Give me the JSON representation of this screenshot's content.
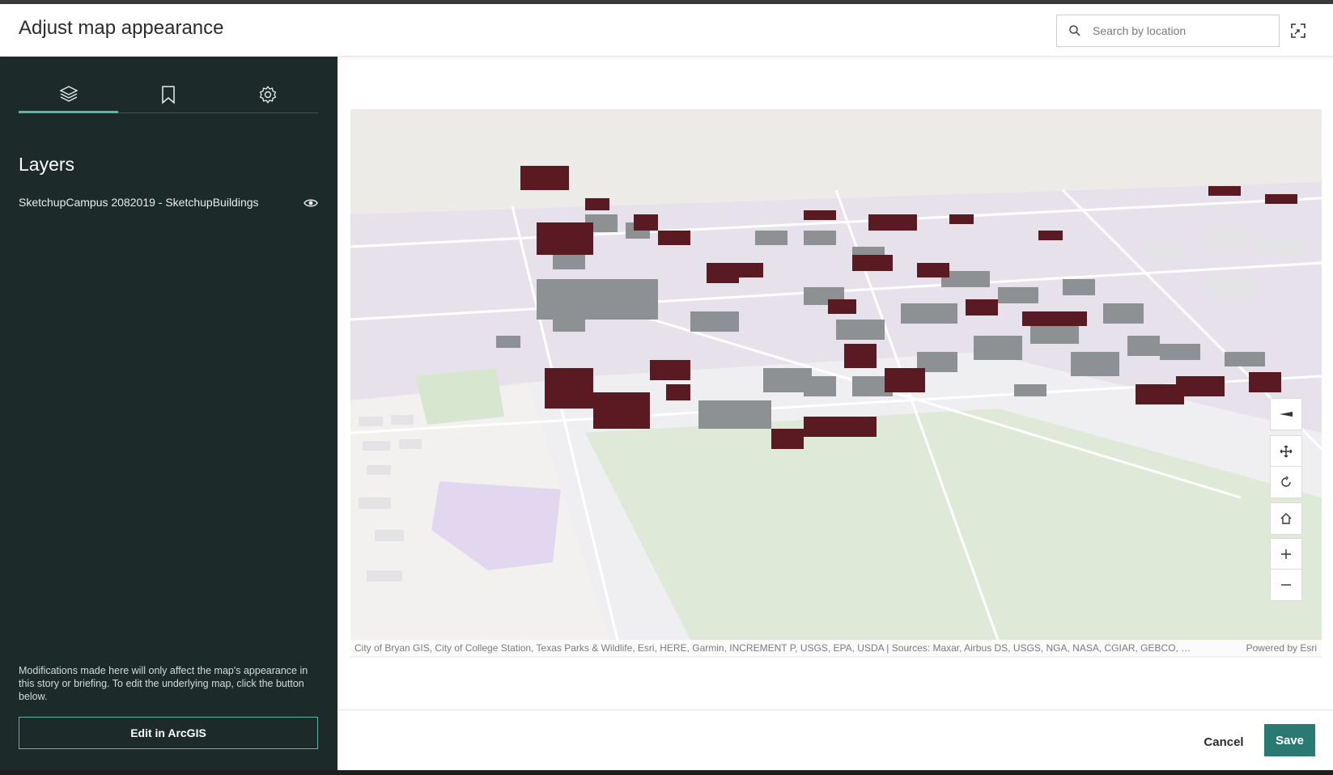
{
  "header": {
    "title": "Adjust map appearance",
    "search_placeholder": "Search by location"
  },
  "sidebar": {
    "tabs": [
      {
        "icon": "layers-icon"
      },
      {
        "icon": "bookmark-icon"
      },
      {
        "icon": "gear-icon"
      }
    ],
    "section_title": "Layers",
    "layers": [
      {
        "name": "SketchupCampus 2082019 - SketchupBuildings",
        "visible": true
      }
    ],
    "note": "Modifications made here will only affect the map's appearance in this story or briefing. To edit the underlying map, click the button below.",
    "edit_button": "Edit in ArcGIS"
  },
  "map": {
    "attribution": "City of Bryan GIS, City of College Station, Texas Parks & Wildlife, Esri, HERE, Garmin, INCREMENT P, USGS, EPA, USDA | Sources: Maxar, Airbus DS, USGS, NGA, NASA, CGIAR, GEBCO, N Robinson, NCE...",
    "powered_by": "Powered by Esri",
    "controls": [
      "compass-icon",
      "pan-icon",
      "rotate-icon",
      "home-icon",
      "zoom-in-icon",
      "zoom-out-icon"
    ],
    "colors": {
      "highlight_building": "#5a1a22",
      "building": "#8e9194",
      "park": "#dfe9d7",
      "campus": "#e4dce9"
    }
  },
  "footer": {
    "cancel": "Cancel",
    "save": "Save"
  },
  "colors": {
    "sidebar_bg": "#1c2a2a",
    "accent": "#2a7a73"
  }
}
